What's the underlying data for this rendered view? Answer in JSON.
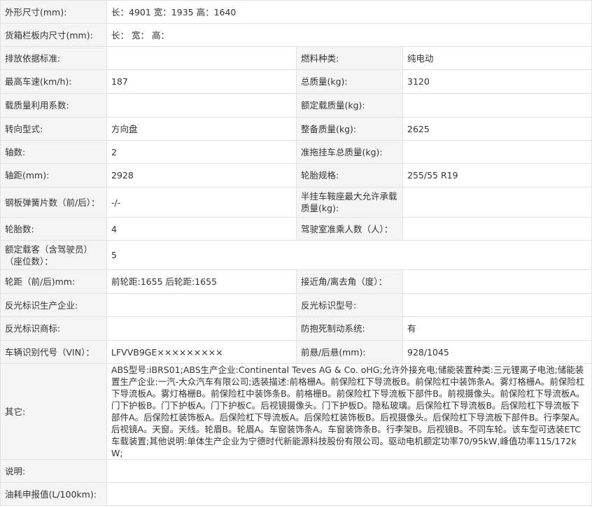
{
  "rows": [
    {
      "type": "wide",
      "label": "外形尺寸(mm):",
      "value": "长：4901 宽：1935 高：1640"
    },
    {
      "type": "wide",
      "label": "货箱栏板内尺寸(mm):",
      "value": "长：  宽：  高："
    },
    {
      "type": "pair",
      "label1": "排放依据标准:",
      "value1": "",
      "label2": "燃料种类:",
      "value2": "纯电动"
    },
    {
      "type": "pair",
      "label1": "最高车速(km/h):",
      "value1": "187",
      "label2": "总质量(kg):",
      "value2": "3120"
    },
    {
      "type": "pair",
      "label1": "载质量利用系数:",
      "value1": "",
      "label2": "额定载质量(kg):",
      "value2": ""
    },
    {
      "type": "pair",
      "label1": "转向型式:",
      "value1": "方向盘",
      "label2": "整备质量(kg):",
      "value2": "2625"
    },
    {
      "type": "pair",
      "label1": "轴数:",
      "value1": "2",
      "label2": "准拖挂车总质量(kg):",
      "value2": ""
    },
    {
      "type": "pair",
      "label1": "轴距(mm):",
      "value1": "2928",
      "label2": "轮胎规格:",
      "value2": "255/55 R19"
    },
    {
      "type": "pair",
      "label1": "钢板弹簧片数（前/后）：",
      "value1": "-/-",
      "label2": "半挂车鞍座最大允许承载质量(kg):",
      "value2": ""
    },
    {
      "type": "pair",
      "label1": "轮胎数:",
      "value1": "4",
      "label2": "驾驶室准乘人数（人）：",
      "value2": ""
    },
    {
      "type": "wide",
      "label": "额定载客（含驾驶员）（座位数）：",
      "value": "5"
    },
    {
      "type": "pair",
      "label1": "轮距（前/后)mm:",
      "value1": "前轮距:1655 后轮距:1655",
      "label2": "接近角/离去角（度）：",
      "value2": ""
    },
    {
      "type": "pair",
      "label1": "反光标识生产企业:",
      "value1": "",
      "label2": "反光标识型号:",
      "value2": ""
    },
    {
      "type": "pair",
      "label1": "反光标识商标:",
      "value1": "",
      "label2": "防抱死制动系统:",
      "value2": "有"
    },
    {
      "type": "pair",
      "label1": "车辆识别代号（VIN）：",
      "value1": "LFVVB9GE×××××××××",
      "label2": "前悬/后悬(mm):",
      "value2": "928/1045"
    },
    {
      "type": "other",
      "label": "其它:",
      "value": "ABS型号:iBRS01;ABS生产企业:Continental Teves AG & Co. oHG;允许外接充电;储能装置种类:三元锂离子电池;储能装置生产企业:一汽-大众汽车有限公司;选装描述:前格栅A。前保险杠下导流板B。前保险杠中装饰条A。雾灯格栅A。前保险杠下导流板A。雾灯格栅B。前保险杠中装饰条B。前格栅B。前保险杠下导流板下部件B。前视摄像头。前保险杠下导流板A。门下护板B。门下护板A。门下护板C。后视镜摄像头。门下护板D。隐私玻璃。后保险杠下导流板B。后保险杠下导流板下部件A。后保险杠装饰板A。后保险杠下导流板A。后保险杠装饰板B。后视摄像头。后保险杠下导流板下部件B。行李架A。后视镜A。天窗。天线。轮眉B。轮眉A。车窗装饰条A。车窗装饰条B。行李架B。后视镜B。不同车轮。该车型可选装ETC车载装置;其他说明:单体生产企业为宁德时代新能源科技股份有限公司。驱动电机额定功率70/95kW,峰值功率115/172kW;"
    },
    {
      "type": "wide",
      "label": "说明:",
      "value": ""
    },
    {
      "type": "wide",
      "label": "油耗申报值(L/100km):",
      "value": ""
    }
  ]
}
